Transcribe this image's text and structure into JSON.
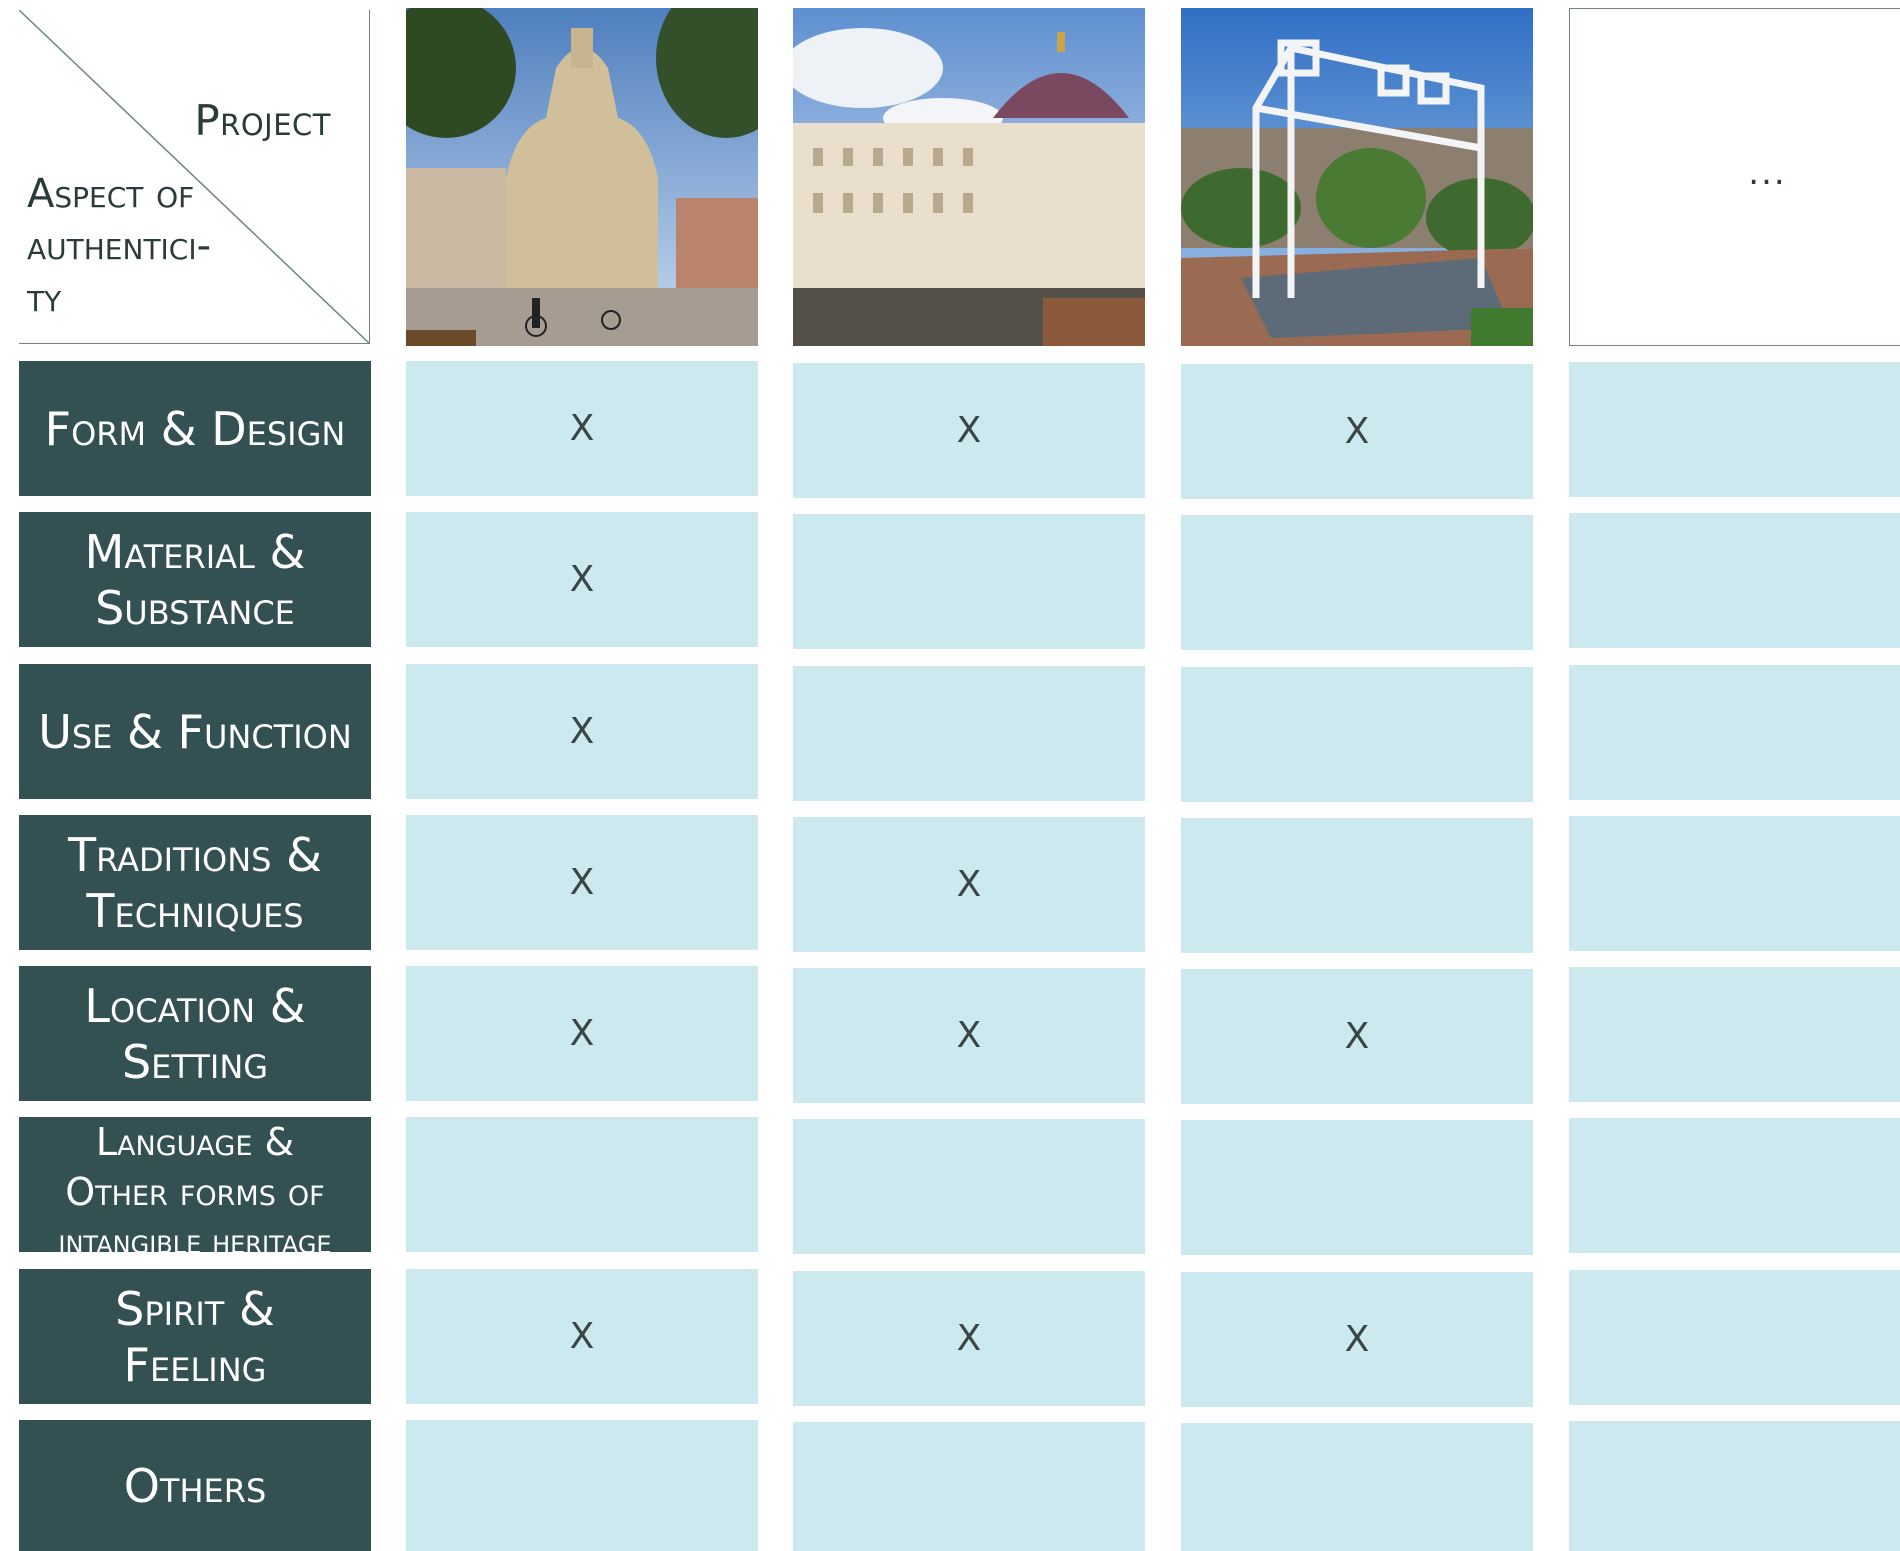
{
  "corner": {
    "project_label": "Project",
    "aspect_label_lines": [
      "Aspect of",
      "authentici-",
      "ty"
    ]
  },
  "projects": [
    {
      "icon": "frauenkirche-dresden-photo"
    },
    {
      "icon": "berlin-palace-humboldt-forum-photo"
    },
    {
      "icon": "franklin-court-ghost-structure-photo"
    },
    {
      "icon": "more-projects-placeholder",
      "label": "..."
    }
  ],
  "rows": [
    {
      "label_lines": [
        "Form & Design"
      ],
      "marks": [
        "X",
        "X",
        "X",
        ""
      ]
    },
    {
      "label_lines": [
        "Material &",
        "Substance"
      ],
      "marks": [
        "X",
        "",
        "",
        ""
      ]
    },
    {
      "label_lines": [
        "Use & Function"
      ],
      "marks": [
        "X",
        "",
        "",
        ""
      ]
    },
    {
      "label_lines": [
        "Traditions &",
        "Techniques"
      ],
      "marks": [
        "X",
        "X",
        "",
        ""
      ]
    },
    {
      "label_lines": [
        "Location &",
        "Setting"
      ],
      "marks": [
        "X",
        "X",
        "X",
        ""
      ]
    },
    {
      "label_lines": [
        "Language &",
        "Other forms of",
        "intangible heritage"
      ],
      "marks": [
        "",
        "",
        "",
        ""
      ]
    },
    {
      "label_lines": [
        "Spirit &",
        "Feeling"
      ],
      "marks": [
        "X",
        "X",
        "X",
        ""
      ]
    },
    {
      "label_lines": [
        "Others"
      ],
      "marks": [
        "",
        "",
        "",
        ""
      ]
    }
  ],
  "colors": {
    "label_bg": "#335052",
    "cell_bg": "#cbe9ee",
    "border": "#6f8584"
  }
}
